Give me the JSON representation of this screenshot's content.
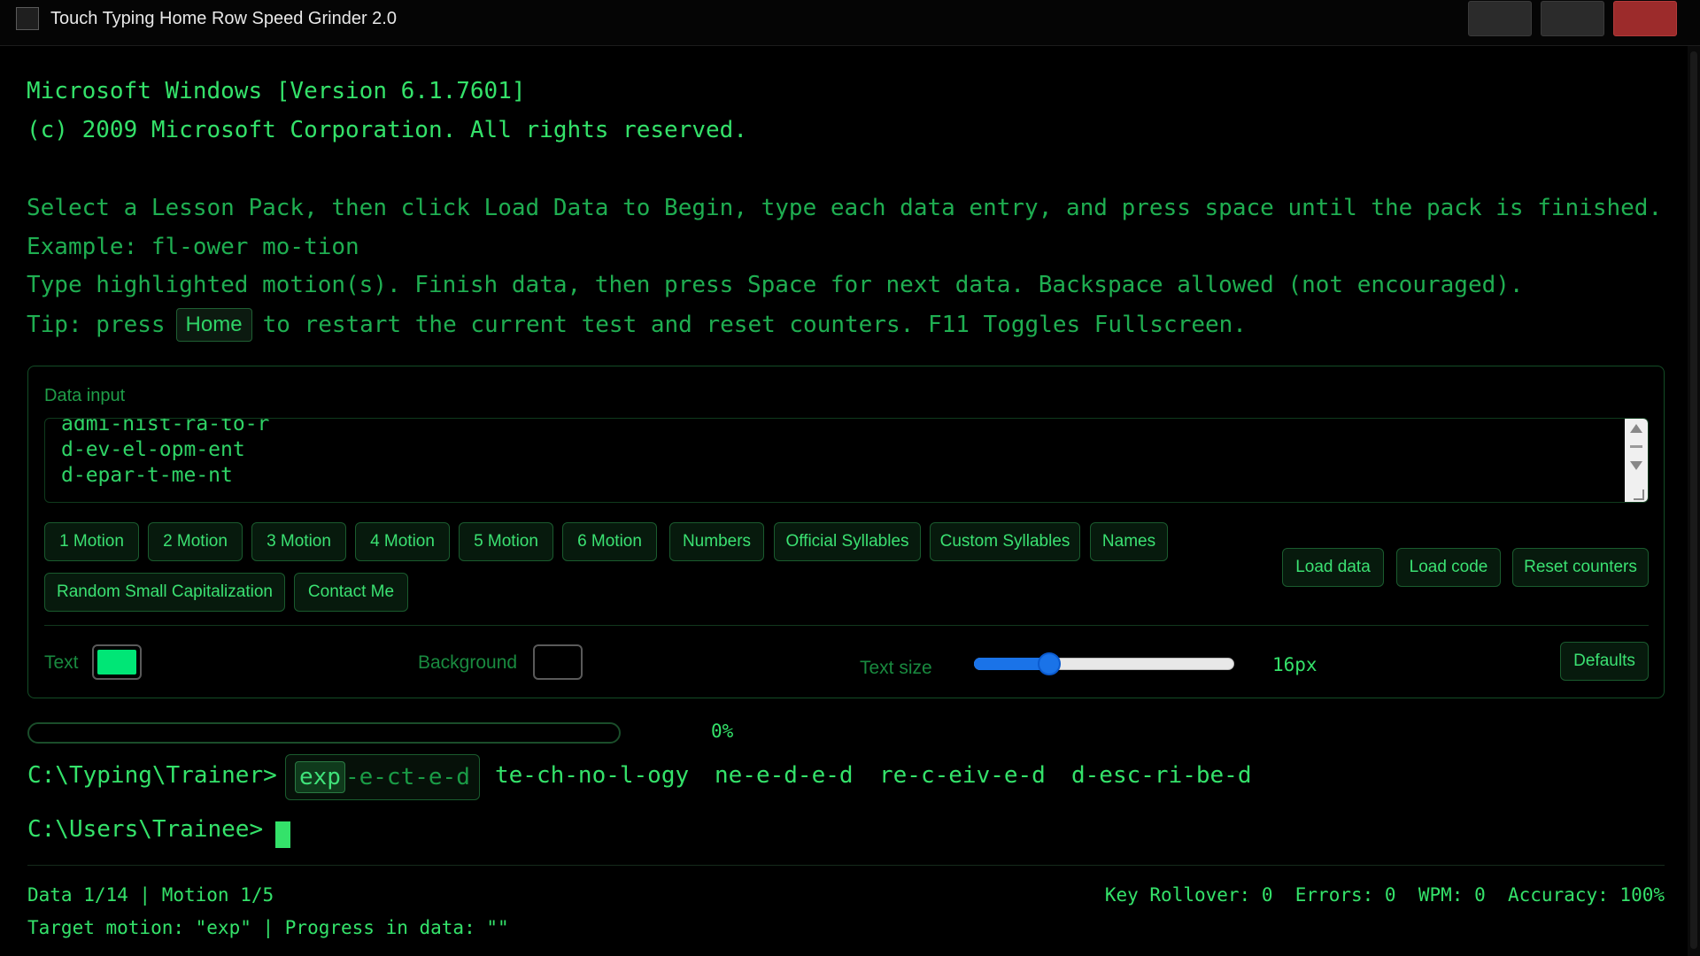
{
  "window": {
    "title": "Touch Typing Home Row Speed Grinder 2.0"
  },
  "console": {
    "line1": "Microsoft Windows [Version 6.1.7601]",
    "line2": "(c) 2009 Microsoft Corporation. All rights reserved.",
    "instructions": "Select a Lesson Pack, then click Load Data to Begin, type each data entry, and press space until the pack is finished.",
    "example": "Example: fl-ower mo-tion",
    "type_hint": "Type highlighted motion(s). Finish data, then press Space for next data. Backspace allowed (not encouraged).",
    "tip_prefix": "Tip: press",
    "tip_key": "Home",
    "tip_suffix": "to restart the current test and reset counters. F11 Toggles Fullscreen."
  },
  "panel": {
    "data_input_label": "Data input",
    "data_lines": [
      "admi-nist-ra-to-r",
      "d-ev-el-opm-ent",
      "d-epar-t-me-nt"
    ],
    "lesson_buttons": [
      "1 Motion",
      "2 Motion",
      "3 Motion",
      "4 Motion",
      "5 Motion",
      "6 Motion",
      "Numbers",
      "Official Syllables",
      "Custom Syllables",
      "Names"
    ],
    "row2_buttons": [
      "Random Small Capitalization",
      "Contact Me"
    ],
    "action_buttons": [
      "Load data",
      "Load code",
      "Reset counters"
    ],
    "text_label": "Text",
    "text_color": "#00e676",
    "background_label": "Background",
    "background_color": "#000000",
    "text_size_label": "Text size",
    "text_size_value": "16px",
    "text_size_fraction": 0.27,
    "defaults_button": "Defaults"
  },
  "progress": {
    "percent_label": "0%",
    "fraction": 0
  },
  "prompt": {
    "trainer_path": "C:\\Typing\\Trainer>",
    "current_word_highlight": "exp",
    "current_word_rest": "-e-ct-e-d",
    "upcoming_words": [
      "te-ch-no-l-ogy",
      "ne-e-d-e-d",
      "re-c-eiv-e-d",
      "d-esc-ri-be-d"
    ],
    "user_path": "C:\\Users\\Trainee>"
  },
  "status": {
    "data_motion": "Data 1/14 | Motion 1/5",
    "target": "Target motion: \"exp\" | Progress in data: \"\"",
    "stats": "Key Rollover: 0  Errors: 0  WPM: 0  Accuracy: 100%"
  }
}
